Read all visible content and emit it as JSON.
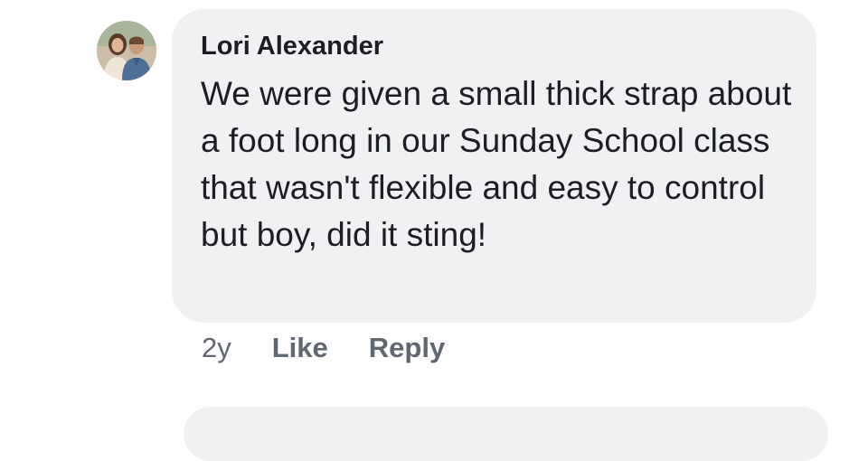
{
  "comment": {
    "author": "Lori Alexander",
    "avatar": "profile-photo-two-people",
    "text": "We were given a small thick strap about a foot long in our Sunday School class that wasn't flexible and easy to control but boy, did it sting!",
    "timestamp": "2y",
    "actions": {
      "like_label": "Like",
      "reply_label": "Reply"
    }
  },
  "colors": {
    "bubble": "#f0f1f3",
    "text": "#1c1e21",
    "meta": "#606770"
  }
}
